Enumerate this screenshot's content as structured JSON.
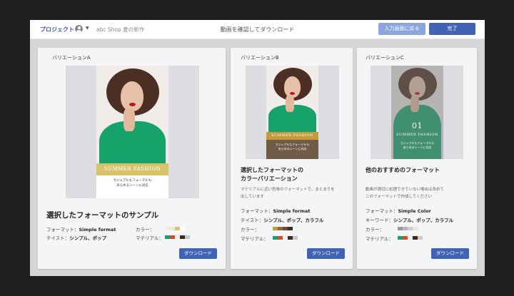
{
  "header": {
    "project_label": "プロジェクト",
    "caret": "▼",
    "shop_name": "abc Shop 夏の新作",
    "title": "動画を確認してダウンロード",
    "back_button": "入力画面に戻る",
    "done_button": "完了"
  },
  "cards": [
    {
      "caption": "バリエーションA",
      "banner_text": "SUMMER FASHION",
      "banner_caption": [
        "カジュアルもフォーマルも",
        "あらゆるシーンに対応"
      ],
      "title": "選択したフォーマットのサンプル",
      "format_label": "フォーマット：",
      "format_value": "Simple format",
      "taste_label": "テイスト：",
      "taste_value": "シンプル、ポップ",
      "color_label": "カラー：",
      "material_label": "マテリアル：",
      "colors": [
        "#f3ebe6",
        "#efe4d9",
        "#d8c36a",
        "#ffffff"
      ],
      "materials": [
        "#17a16b",
        "#d94a2a",
        "#eeeeee",
        "#3a2a22",
        "#c9c9c9"
      ],
      "download": "ダウンロード"
    },
    {
      "caption": "バリエーションB",
      "banner_text": "SUMMER FASHION",
      "banner_caption": [
        "カジュアルもフォーマルも",
        "あらゆるシーンに対応"
      ],
      "title_lines": [
        "選択したフォーマットの",
        "カラーバリエーション"
      ],
      "description_lines": [
        "マテリアルに近い色味のフォーマットで、まとまりを",
        "出しています"
      ],
      "format_label": "フォーマット：",
      "format_value": "Simple format",
      "taste_label": "テイスト：",
      "taste_value": "シンプル、ポップ、カラフル",
      "color_label": "カラー：",
      "material_label": "マテリアル：",
      "colors": [
        "#c49a3c",
        "#8a6a42",
        "#6b4b33",
        "#3d2c22"
      ],
      "materials": [
        "#17a16b",
        "#d94a2a",
        "#eeeeee",
        "#3a2a22",
        "#c9c9c9"
      ],
      "download": "ダウンロード"
    },
    {
      "caption": "バリエーションC",
      "big_number": "01",
      "banner_text": "SUMMER FASHION",
      "banner_caption": [
        "カジュアルもフォーマルも",
        "あらゆるシーンに対応"
      ],
      "title": "他のおすすめのフォーマット",
      "description_lines": [
        "動画が適切に処理できていない場合は改めて",
        "このフォーマットで作成してください"
      ],
      "format_label": "フォーマット：",
      "format_value": "Simple Color",
      "keyword_label": "キーワード：",
      "keyword_value": "シンプル、ポップ、カラフル",
      "color_label": "カラー：",
      "material_label": "マテリアル：",
      "colors": [
        "#9a9a9a",
        "#b5b5b5",
        "#cfcfcf",
        "#e5e5e5"
      ],
      "materials": [
        "#17a16b",
        "#d94a2a",
        "#eeeeee",
        "#3a2a22",
        "#c9c9c9"
      ],
      "download": "ダウンロード"
    }
  ]
}
